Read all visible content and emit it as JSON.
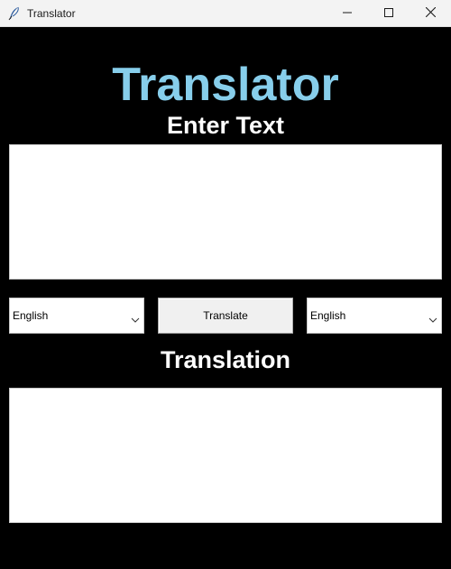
{
  "window": {
    "title": "Translator"
  },
  "header": {
    "app_title": "Translator"
  },
  "input_section": {
    "label": "Enter Text",
    "value": ""
  },
  "controls": {
    "source_language": "English",
    "translate_label": "Translate",
    "target_language": "English"
  },
  "output_section": {
    "label": "Translation",
    "value": ""
  },
  "colors": {
    "background": "#000000",
    "title_accent": "#87ceeb",
    "label_text": "#ffffff"
  },
  "icons": {
    "app": "feather-icon",
    "minimize": "minimize-icon",
    "maximize": "maximize-icon",
    "close": "close-icon",
    "dropdown": "chevron-down-icon"
  }
}
